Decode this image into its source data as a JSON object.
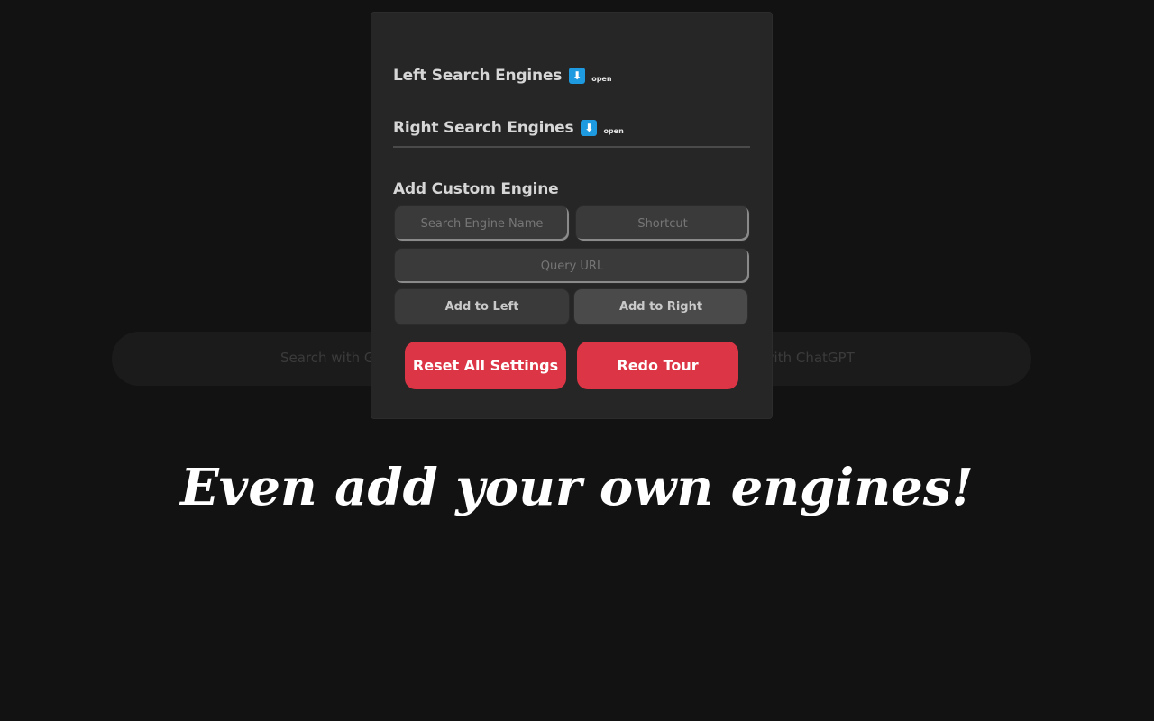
{
  "background_search": {
    "left_placeholder": "Search with Go",
    "right_placeholder": "h with ChatGPT"
  },
  "panel": {
    "left_engines": {
      "title": "Left Search Engines",
      "icon": "down-arrow-icon",
      "toggle_label": "open"
    },
    "right_engines": {
      "title": "Right Search Engines",
      "icon": "down-arrow-icon",
      "toggle_label": "open"
    },
    "custom": {
      "title": "Add Custom Engine",
      "name_placeholder": "Search Engine Name",
      "shortcut_placeholder": "Shortcut",
      "url_placeholder": "Query URL",
      "add_left_label": "Add to Left",
      "add_right_label": "Add to Right"
    },
    "reset_label": "Reset All Settings",
    "tour_label": "Redo Tour"
  },
  "headline": "Even add your own engines!",
  "colors": {
    "background": "#121212",
    "panel": "#262626",
    "accent_red": "#dc3545",
    "accent_blue": "#1e9ae0"
  }
}
